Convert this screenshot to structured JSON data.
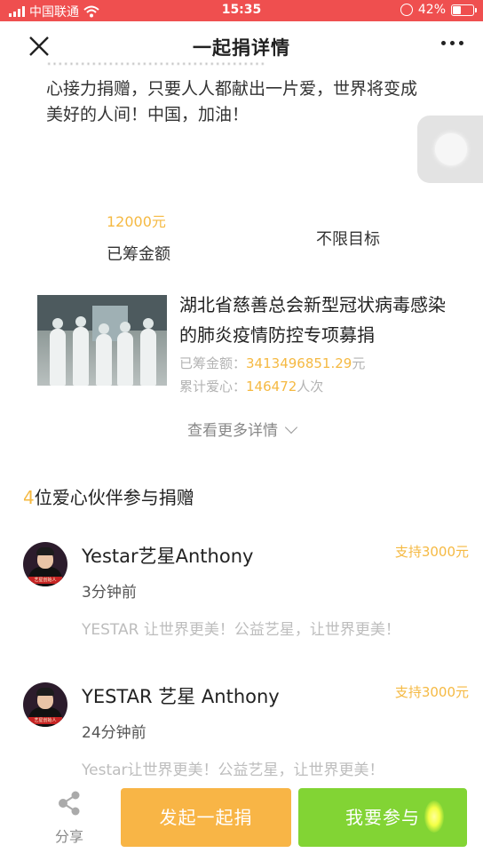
{
  "status_bar": {
    "carrier": "中国联通",
    "time": "15:35",
    "battery": "42%",
    "battery_level": 0.42
  },
  "nav": {
    "title": "一起捐详情"
  },
  "intro": {
    "faded_line": "…………………………………",
    "text_line1": "心接力捐赠，只要人人都献出一片爱，世界将变成",
    "text_line2": "美好的人间！中国，加油！"
  },
  "raise": {
    "amount": "12000元",
    "amount_label": "已筹金额",
    "target_label": "不限目标"
  },
  "project": {
    "title": "湖北省慈善总会新型冠状病毒感染的肺炎疫情防控专项募捐",
    "raised_label": "已筹金额：",
    "raised_value": "3413496851.29",
    "raised_unit": "元",
    "love_label": "累计爱心：",
    "love_value": "146472",
    "love_unit": "人次",
    "more_details": "查看更多详情"
  },
  "partners": {
    "count": "4",
    "heading": "位爱心伙伴参与捐赠",
    "donors": [
      {
        "name": "Yestar艺星Anthony",
        "support": "支持3000元",
        "time": "3分钟前",
        "message": "YESTAR 让世界更美！公益艺星，让世界更美！",
        "avatar_tag": "艺星创始人"
      },
      {
        "name": "YESTAR 艺星 Anthony",
        "support": "支持3000元",
        "time": "24分钟前",
        "message": "Yestar让世界更美！公益艺星，让世界更美！",
        "avatar_tag": "艺星创始人"
      }
    ]
  },
  "bottom": {
    "share_label": "分享",
    "start_button": "发起一起捐",
    "join_button": "我要参与"
  },
  "colors": {
    "status_bar": "#ef4f4f",
    "accent_orange": "#f5b942",
    "start_button": "#f8b546",
    "join_button": "#82d434"
  }
}
